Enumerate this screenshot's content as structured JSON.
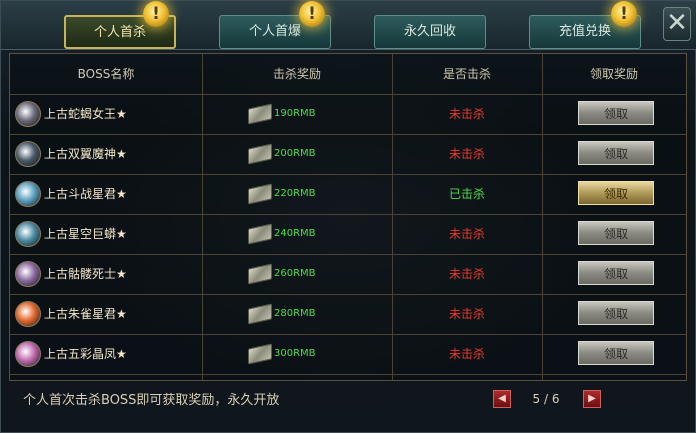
{
  "tabs": [
    {
      "label": "个人首杀",
      "active": true
    },
    {
      "label": "个人首爆",
      "active": false
    },
    {
      "label": "永久回收",
      "active": false
    },
    {
      "label": "充值兑换",
      "active": false
    }
  ],
  "notice_icon": "!",
  "close_icon": "✕",
  "table": {
    "headers": [
      "BOSS名称",
      "击杀奖励",
      "是否击杀",
      "领取奖励"
    ],
    "rows": [
      {
        "boss": "上古蛇蝎女王★",
        "reward": "190RMB",
        "status": "未击杀",
        "killed": false,
        "claim": "领取"
      },
      {
        "boss": "上古双翼魔神★",
        "reward": "200RMB",
        "status": "未击杀",
        "killed": false,
        "claim": "领取"
      },
      {
        "boss": "上古斗战星君★",
        "reward": "220RMB",
        "status": "已击杀",
        "killed": true,
        "claim": "领取"
      },
      {
        "boss": "上古星空巨蟒★",
        "reward": "240RMB",
        "status": "未击杀",
        "killed": false,
        "claim": "领取"
      },
      {
        "boss": "上古骷髅死士★",
        "reward": "260RMB",
        "status": "未击杀",
        "killed": false,
        "claim": "领取"
      },
      {
        "boss": "上古朱雀星君★",
        "reward": "280RMB",
        "status": "未击杀",
        "killed": false,
        "claim": "领取"
      },
      {
        "boss": "上古五彩晶凤★",
        "reward": "300RMB",
        "status": "未击杀",
        "killed": false,
        "claim": "领取"
      }
    ]
  },
  "footer": {
    "note": "个人首次击杀BOSS即可获取奖励，永久开放",
    "page": "5 / 6",
    "prev_icon": "◀",
    "next_icon": "▶"
  },
  "colors": {
    "not_killed": "#e83a2a",
    "killed": "#4edc4e"
  },
  "avatar_colors": [
    "#6a6a7a",
    "#4a5a6a",
    "#5aa0c0",
    "#4a8aa0",
    "#8a6aa0",
    "#e06a30",
    "#c06ab0"
  ]
}
